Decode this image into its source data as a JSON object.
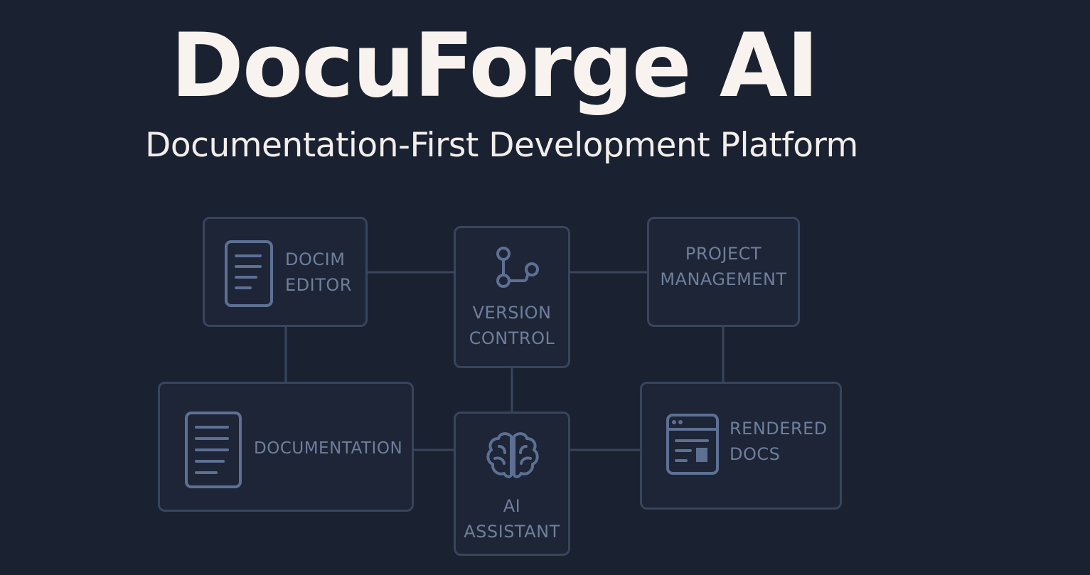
{
  "header": {
    "title": "DocuForge AI",
    "subtitle": "Documentation-First Development Platform"
  },
  "nodes": {
    "docim_editor": {
      "label": "DOCIM\nEDITOR",
      "icon": "document-icon"
    },
    "version_control": {
      "label": "VERSION\nCONTROL",
      "icon": "git-branch-icon"
    },
    "project_management": {
      "label": "PROJECT\nMANAGEMENT"
    },
    "documentation": {
      "label": "DOCUMENTATION",
      "icon": "document-icon"
    },
    "ai_assistant": {
      "label": "AI\nASSISTANT",
      "icon": "brain-icon"
    },
    "rendered_docs": {
      "label": "RENDERED\nDOCS",
      "icon": "browser-window-icon"
    }
  },
  "colors": {
    "background": "#1a2130",
    "title": "#f8f3ef",
    "node_border": "#38455c",
    "node_text": "#6e7f9c",
    "icon_stroke": "#5d7094"
  }
}
